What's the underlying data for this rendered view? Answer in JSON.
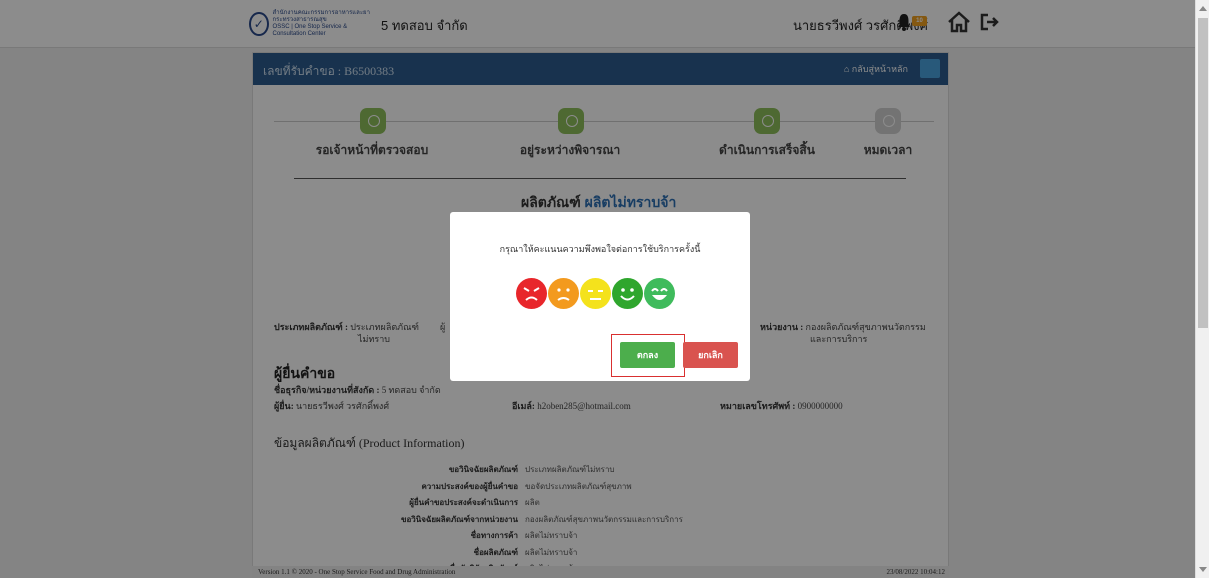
{
  "header": {
    "logo_lines": [
      "สำนักงานคณะกรรมการอาหารและยา",
      "กระทรวงสาธารณสุข",
      "OSSC | One Stop Service & Consultation Center"
    ],
    "company_name": "5 ทดสอบ จำกัด",
    "user_name": "นายธรวีพงศ์ วรศักดิ์พงศ์",
    "notification_count": "10"
  },
  "panel": {
    "request_no": "เลขที่รับคำขอ : B6500383",
    "back_label": "กลับสู่หน้าหลัก"
  },
  "steps": [
    {
      "label": "รอเจ้าหน้าที่ตรวจสอบ",
      "done": true
    },
    {
      "label": "อยู่ระหว่างพิจารณา",
      "done": true
    },
    {
      "label": "ดำเนินการเสร็จสิ้น",
      "done": true
    },
    {
      "label": "หมดเวลา",
      "done": false
    }
  ],
  "product": {
    "prefix": "ผลิตภัณฑ์",
    "name": "ผลิตไม่ทราบจ้า",
    "type_label": "ประเภทผลิตภัณฑ์ :",
    "type_value_1": "ประเภทผลิตภัณฑ์",
    "type_value_2": "ไม่ทราบ",
    "agency_label_fragment": "ผู้",
    "dept_label": "หน่วยงาน :",
    "dept_value_1": "กองผลิตภัณฑ์สุขภาพนวัตกรรม",
    "dept_value_2": "และการบริการ"
  },
  "applicant": {
    "title": "ผู้ยื่นคำขอ",
    "org_label": "ชื่อธุรกิจ/หน่วยงานที่สังกัด :",
    "org_value": "5 ทดสอบ จำกัด",
    "name_label": "ผู้ยื่น:",
    "name_value": "นายธรวีพงศ์ วรศักดิ์พงศ์",
    "email_label": "อีเมล์:",
    "email_value": "h2oben285@hotmail.com",
    "phone_label": "หมายเลขโทรศัพท์ :",
    "phone_value": "0900000000"
  },
  "product_info": {
    "title_th": "ข้อมูลผลิตภัณฑ์",
    "title_en": "(Product Information)",
    "rows": [
      {
        "label": "ขอวินิจฉัยผลิตภัณฑ์",
        "value": "ประเภทผลิตภัณฑ์ไม่ทราบ"
      },
      {
        "label": "ความประสงค์ของผู้ยื่นคำขอ",
        "value": "ขอจัดประเภทผลิตภัณฑ์สุขภาพ"
      },
      {
        "label": "ผู้ยื่นคำขอประสงค์จะดำเนินการ",
        "value": "ผลิต"
      },
      {
        "label": "ขอวินิจฉัยผลิตภัณฑ์จากหน่วยงาน",
        "value": "กองผลิตภัณฑ์สุขภาพนวัตกรรมและการบริการ"
      },
      {
        "label": "ชื่อทางการค้า",
        "value": "ผลิตไม่ทราบจ้า"
      },
      {
        "label": "ชื่อผลิตภัณฑ์",
        "value": "ผลิตไม่ทราบจ้า"
      },
      {
        "label": "ชื่อนักวิจัยผลิตภัณฑ์",
        "value": "ผลิตไม่ทราบจ้า"
      }
    ]
  },
  "footer": {
    "version": "Version 1.1 © 2020 - One Stop Service Food and Drug Administration",
    "datetime": "23/08/2022 10:04:12"
  },
  "modal": {
    "question": "กรุณาให้คะแนนความพึงพอใจต่อการใช้บริการครั้งนี้",
    "ok_label": "ตกลง",
    "cancel_label": "ยกเลิก",
    "ratings": [
      {
        "name": "very-angry-face-icon",
        "color": "#e8262b"
      },
      {
        "name": "sad-face-icon",
        "color": "#f39a1e"
      },
      {
        "name": "neutral-face-icon",
        "color": "#f4e21c"
      },
      {
        "name": "smile-face-icon",
        "color": "#2fa62d"
      },
      {
        "name": "grin-face-icon",
        "color": "#3fbb5c"
      }
    ]
  }
}
